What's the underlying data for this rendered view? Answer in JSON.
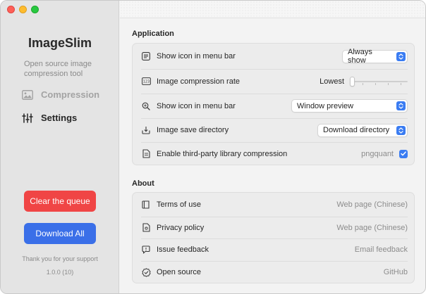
{
  "sidebar": {
    "app_title": "ImageSlim",
    "subtitle": "Open source image compression tool",
    "nav": [
      {
        "label": "Compression",
        "icon": "image-icon",
        "active": false
      },
      {
        "label": "Settings",
        "icon": "sliders-icon",
        "active": true
      }
    ],
    "clear_button": "Clear the queue",
    "download_button": "Download All",
    "thanks": "Thank you for your support",
    "version": "1.0.0 (10)"
  },
  "application": {
    "title": "Application",
    "rows": [
      {
        "label": "Show icon in menu bar",
        "icon": "menu-bar-icon",
        "control": "popup",
        "value": "Always show"
      },
      {
        "label": "Image compression rate",
        "icon": "rate-123-icon",
        "control": "slider",
        "value": "Lowest",
        "level": 0
      },
      {
        "label": "Show icon in menu bar",
        "icon": "zoom-icon",
        "control": "popup",
        "value": "Window preview"
      },
      {
        "label": "Image save directory",
        "icon": "tray-download-icon",
        "control": "popup",
        "value": "Download directory"
      },
      {
        "label": "Enable third-party library compression",
        "icon": "document-icon",
        "control": "checkbox",
        "value": "pngquant",
        "checked": true
      }
    ]
  },
  "about": {
    "title": "About",
    "rows": [
      {
        "label": "Terms of use",
        "icon": "book-icon",
        "value": "Web page (Chinese)"
      },
      {
        "label": "Privacy policy",
        "icon": "privacy-document-icon",
        "value": "Web page (Chinese)"
      },
      {
        "label": "Issue feedback",
        "icon": "feedback-bubble-icon",
        "value": "Email feedback"
      },
      {
        "label": "Open source",
        "icon": "checkmark-seal-icon",
        "value": "GitHub"
      }
    ]
  },
  "colors": {
    "accent": "#3a7cf2",
    "clear_button": "#f04545",
    "download_button": "#3a6fe8"
  }
}
